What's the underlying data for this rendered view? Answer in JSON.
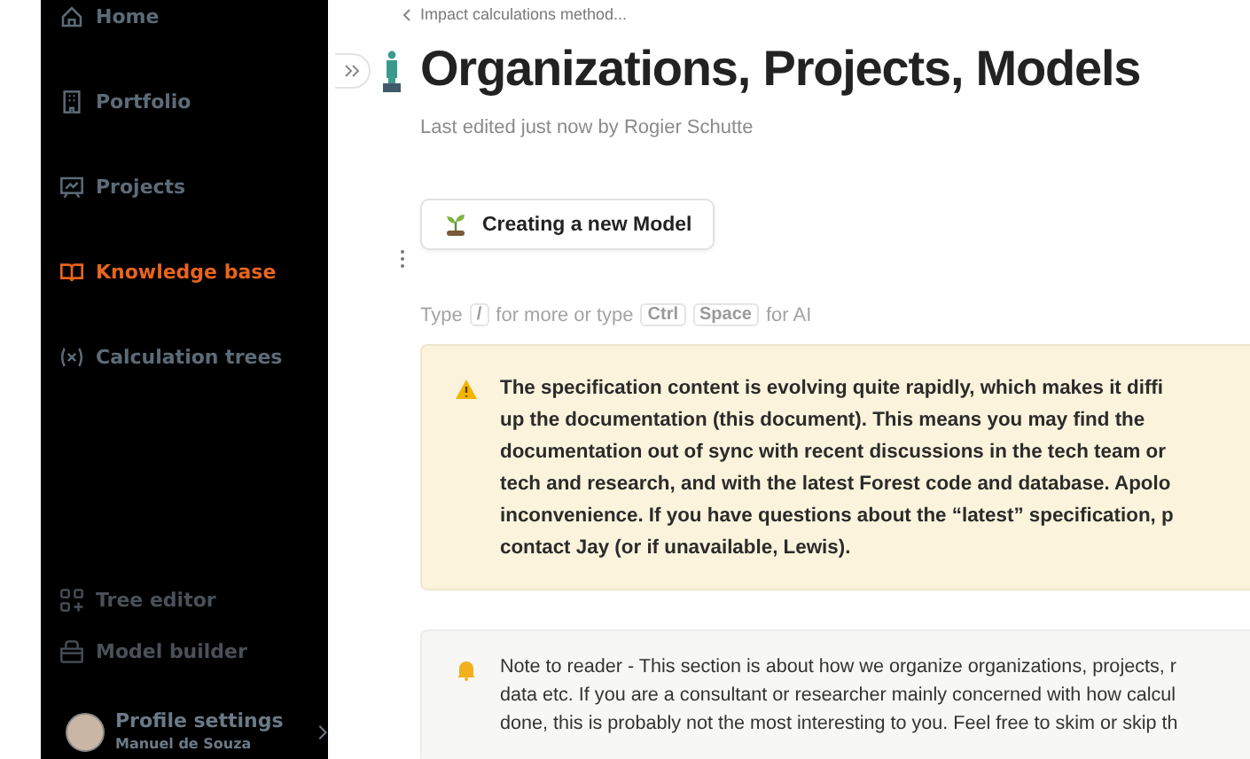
{
  "sidebar": {
    "items": [
      {
        "label": "Home",
        "selected": false,
        "disabled": false
      },
      {
        "label": "Portfolio",
        "selected": false,
        "disabled": false
      },
      {
        "label": "Projects",
        "selected": false,
        "disabled": false
      },
      {
        "label": "Knowledge base",
        "selected": true,
        "disabled": false
      },
      {
        "label": "Calculation trees",
        "selected": false,
        "disabled": false
      }
    ],
    "tools": [
      {
        "label": "Tree editor",
        "disabled": true
      },
      {
        "label": "Model builder",
        "disabled": true
      }
    ],
    "profile": {
      "label": "Profile settings",
      "name": "Manuel de Souza"
    }
  },
  "page": {
    "breadcrumb": "Impact calculations method...",
    "title": "Organizations, Projects, Models",
    "subtitle": "Last edited just now by Rogier Schutte",
    "link_card": {
      "label": "Creating a new Model"
    },
    "hint": [
      {
        "kind": "text",
        "text": "Type"
      },
      {
        "kind": "key",
        "text": "/"
      },
      {
        "kind": "text",
        "text": "for more or type"
      },
      {
        "kind": "key",
        "text": "Ctrl"
      },
      {
        "kind": "key",
        "text": "Space"
      },
      {
        "kind": "text",
        "text": "for AI"
      }
    ],
    "callouts": [
      {
        "kind": "warning",
        "lines": [
          "The specification content is evolving quite rapidly, which makes it diffi",
          "up the documentation (this document). This means you may find the",
          "documentation out of sync with recent discussions in the tech team or",
          "tech and research, and with the latest Forest code and database. Apolo",
          "inconvenience. If you have questions about the “latest” specification, p",
          "contact Jay (or if unavailable, Lewis)."
        ]
      },
      {
        "kind": "note",
        "lines": [
          "Note to reader - This section is about how we organize organizations, projects, r",
          "data etc. If you are a consultant or researcher mainly concerned with how calcul",
          "done, this is probably not the most interesting to you. Feel free to skim or skip th"
        ]
      }
    ]
  }
}
